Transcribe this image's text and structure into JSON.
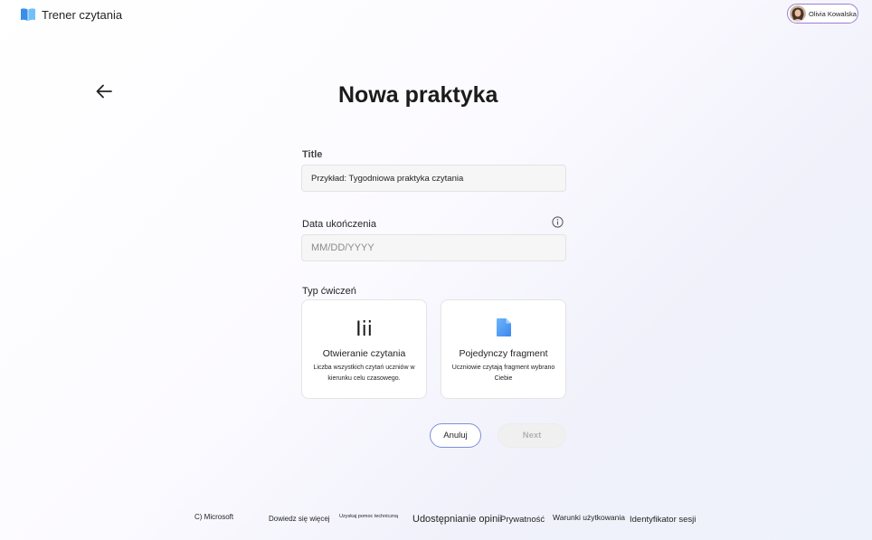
{
  "header": {
    "app_title": "Trener czytania",
    "user_name": "Olivia Kowalska"
  },
  "page": {
    "title": "Nowa praktyka"
  },
  "form": {
    "title_label": "Title",
    "title_placeholder": "Przykład: Tygodniowa praktyka czytania",
    "date_label": "Data ukończenia",
    "date_placeholder": "MM/DD/YYYY",
    "type_label": "Typ ćwiczeń",
    "cards": [
      {
        "glyph": "Iii",
        "title": "Otwieranie czytania",
        "description": "Liczba wszystkich czytań uczniów w kierunku celu czasowego."
      },
      {
        "icon": "document-icon",
        "title": "Pojedynczy fragment",
        "description": "Uczniowie czytają fragment wybrano Ciebie"
      }
    ]
  },
  "actions": {
    "cancel_label": "Anuluj",
    "next_label": "Next"
  },
  "footer": {
    "copyright": "C) Microsoft",
    "learn_more": "Dowiedz się więcej",
    "get_help": "Uzyskaj pomoc techniczną",
    "feedback": "Udostępnianie opinii",
    "privacy": "Prywatność",
    "terms": "Warunki użytkowania",
    "session_id": "Identyfikator sesji"
  },
  "colors": {
    "accent": "#7f8ed9",
    "profile_border": "#9a7fd6",
    "doc_icon": "#4f9bf5"
  }
}
